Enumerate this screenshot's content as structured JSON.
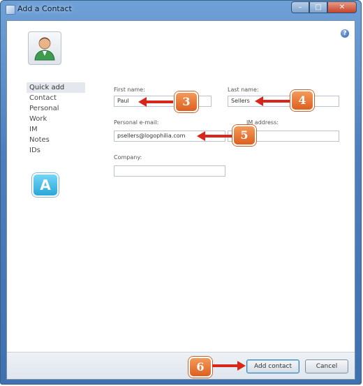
{
  "window": {
    "title": "Add a Contact",
    "close_glyph": "✕",
    "min_glyph": "–",
    "max_glyph": "□"
  },
  "help_icon_glyph": "?",
  "sidebar": {
    "items": [
      {
        "label": "Quick add"
      },
      {
        "label": "Contact"
      },
      {
        "label": "Personal"
      },
      {
        "label": "Work"
      },
      {
        "label": "IM"
      },
      {
        "label": "Notes"
      },
      {
        "label": "IDs"
      }
    ]
  },
  "form": {
    "first_name_label": "First name:",
    "first_name_value": "Paul",
    "last_name_label": "Last name:",
    "last_name_value": "Sellers",
    "email_label": "Personal e-mail:",
    "email_value": "psellers@logophilia.com",
    "im_label": "IM address:",
    "im_value": "",
    "company_label": "Company:",
    "company_value": ""
  },
  "callouts": {
    "a": "A",
    "three": "3",
    "four": "4",
    "five": "5",
    "six": "6"
  },
  "footer": {
    "add_contact_label": "Add contact",
    "cancel_label": "Cancel"
  },
  "colors": {
    "titlebar": "#4d7fbd",
    "callout_orange": "#dd5f1f",
    "callout_blue": "#29a7da",
    "arrow_red": "#d9261b"
  },
  "icons": [
    "window-icon",
    "help-icon",
    "contact-avatar-icon"
  ]
}
